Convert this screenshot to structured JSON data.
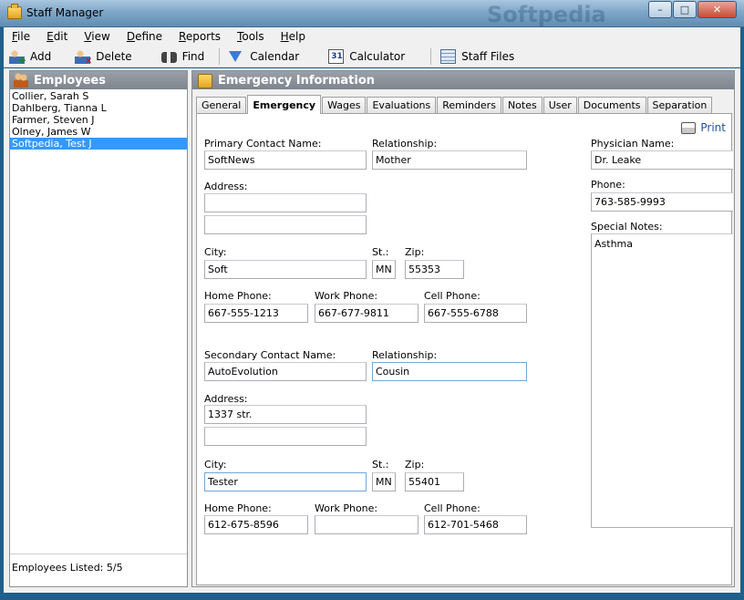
{
  "window": {
    "title": "Staff Manager",
    "watermark": "Softpedia",
    "controls": {
      "minimize": "–",
      "maximize": "□",
      "close": "✕"
    }
  },
  "menu": {
    "items": [
      {
        "first": "F",
        "rest": "ile"
      },
      {
        "first": "E",
        "rest": "dit"
      },
      {
        "first": "V",
        "rest": "iew"
      },
      {
        "first": "D",
        "rest": "efine"
      },
      {
        "first": "R",
        "rest": "eports"
      },
      {
        "first": "T",
        "rest": "ools"
      },
      {
        "first": "H",
        "rest": "elp"
      }
    ]
  },
  "toolbar": {
    "add": "Add",
    "delete": "Delete",
    "find": "Find",
    "calendar": "Calendar",
    "calculator": "Calculator",
    "staff_files": "Staff Files"
  },
  "employees": {
    "header": "Employees",
    "items": [
      "Collier, Sarah S",
      "Dahlberg, Tianna L",
      "Farmer, Steven J",
      "Olney, James W",
      "Softpedia, Test J"
    ],
    "selected_index": 4,
    "footer": "Employees Listed: 5/5"
  },
  "info": {
    "header": "Emergency Information",
    "tabs": [
      "General",
      "Emergency",
      "Wages",
      "Evaluations",
      "Reminders",
      "Notes",
      "User",
      "Documents",
      "Separation"
    ],
    "active_tab": "Emergency",
    "print": "Print"
  },
  "labels": {
    "primary_contact": "Primary Contact Name:",
    "secondary_contact": "Secondary Contact Name:",
    "relationship": "Relationship:",
    "address": "Address:",
    "city": "City:",
    "state": "St.:",
    "zip": "Zip:",
    "home_phone": "Home Phone:",
    "work_phone": "Work Phone:",
    "cell_phone": "Cell Phone:",
    "physician": "Physician Name:",
    "phone": "Phone:",
    "special_notes": "Special Notes:"
  },
  "primary": {
    "name": "SoftNews",
    "relationship": "Mother",
    "address1": "",
    "address2": "",
    "city": "Soft",
    "state": "MN",
    "zip": "55353",
    "home_phone": "667-555-1213",
    "work_phone": "667-677-9811",
    "cell_phone": "667-555-6788"
  },
  "secondary": {
    "name": "AutoEvolution",
    "relationship": "Cousin",
    "address1": "1337 str.",
    "address2": "",
    "city": "Tester",
    "state": "MN",
    "zip": "55401",
    "home_phone": "612-675-8596",
    "work_phone": "",
    "cell_phone": "612-701-5468"
  },
  "physician": {
    "name": "Dr. Leake",
    "phone": "763-585-9993",
    "notes": "Asthma"
  }
}
